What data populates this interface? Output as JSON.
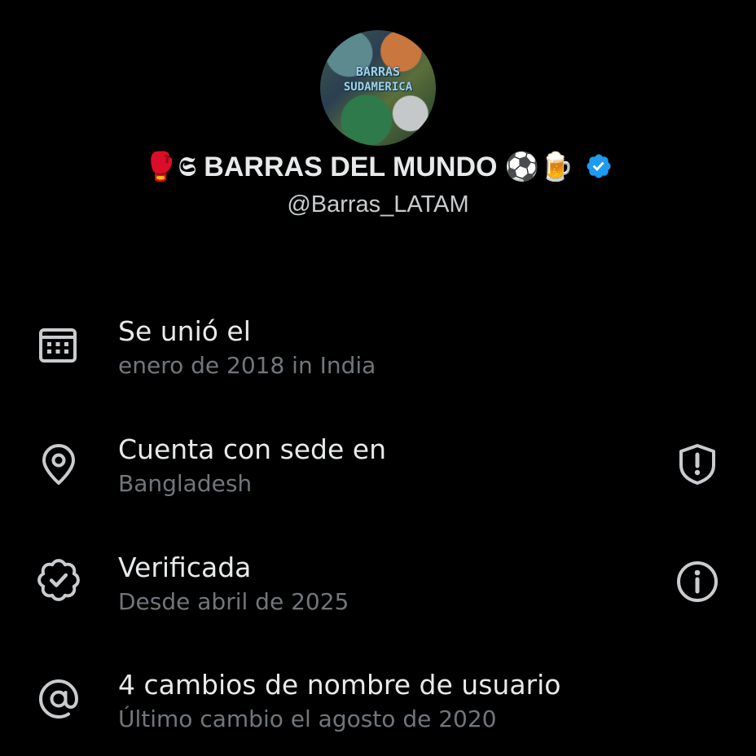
{
  "profile": {
    "avatar_text_line1": "BARRAS",
    "avatar_text_line2": "SUDAMERICA",
    "name_prefix_emoji": "🥊𝕾",
    "name_text": "BARRAS DEL MUNDO",
    "name_suffix_emoji": "⚽🍺",
    "handle": "@Barras_LATAM"
  },
  "rows": [
    {
      "icon": "calendar-icon",
      "title": "Se unió el",
      "subtitle": "enero de 2018 in India"
    },
    {
      "icon": "location-pin-icon",
      "title": "Cuenta con sede en",
      "subtitle": "Bangladesh",
      "action_icon": "shield-alert-icon"
    },
    {
      "icon": "verified-badge-icon",
      "title": "Verificada",
      "subtitle": "Desde abril de 2025",
      "action_icon": "info-icon"
    },
    {
      "icon": "at-sign-icon",
      "title": "4 cambios de nombre de usuario",
      "subtitle": "Último cambio el agosto de 2020"
    }
  ],
  "colors": {
    "background": "#000000",
    "primary_text": "#e7e9ea",
    "secondary_text": "#71767b",
    "icon": "#c9cccf",
    "verified_blue": "#1d9bf0"
  }
}
